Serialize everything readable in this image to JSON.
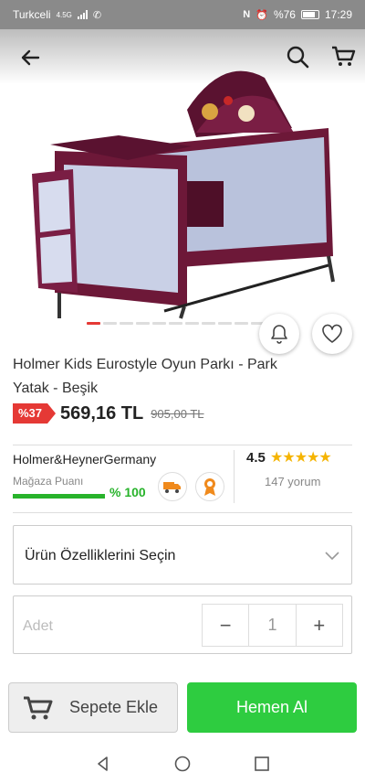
{
  "status": {
    "carrier": "Turkceli",
    "network": "4.5G",
    "battery": "%76",
    "time": "17:29"
  },
  "product": {
    "title": "Holmer Kids Eurostyle Oyun Parkı - Park Yatak - Beşik",
    "discount": "%37",
    "price": "569,16 TL",
    "old_price": "905,00 TL",
    "image_count": 11,
    "active_image": 1
  },
  "seller": {
    "name": "Holmer&HeynerGermany",
    "score_label": "Mağaza Puanı",
    "score_value": "% 100",
    "score_fraction": 1.0
  },
  "rating": {
    "value": "4.5",
    "stars": "★★★★★",
    "reviews": "147 yorum"
  },
  "variant": {
    "label": "Ürün Özelliklerini Seçin"
  },
  "quantity": {
    "label": "Adet",
    "value": "1"
  },
  "actions": {
    "add_to_cart": "Sepete Ekle",
    "buy_now": "Hemen Al"
  },
  "colors": {
    "accent": "#e53935",
    "green": "#2ecc40",
    "star": "#f5b400"
  }
}
